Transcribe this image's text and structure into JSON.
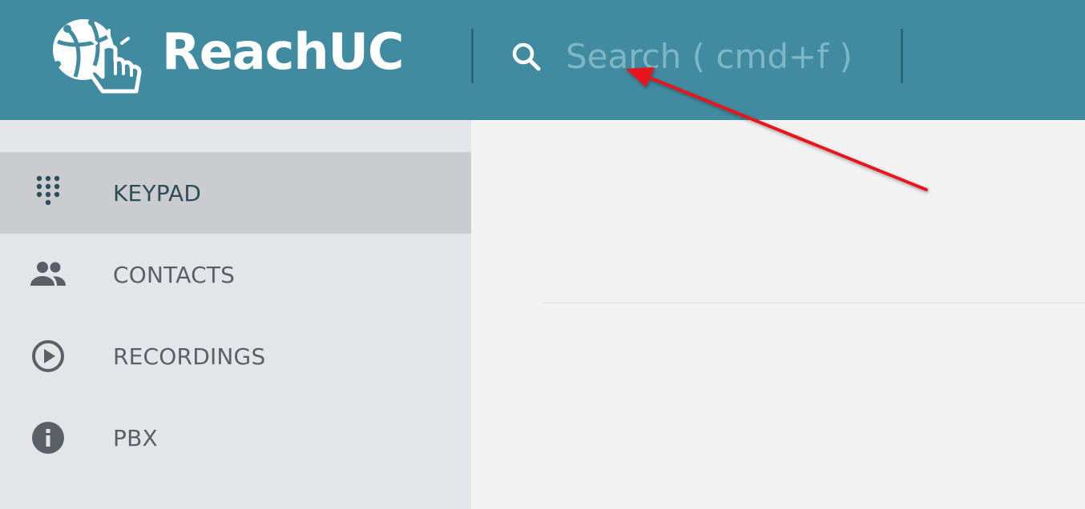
{
  "app": {
    "name": "ReachUC"
  },
  "search": {
    "placeholder": "Search ( cmd+f )",
    "value": ""
  },
  "sidebar": {
    "items": [
      {
        "label": "KEYPAD",
        "icon": "keypad-icon",
        "active": true
      },
      {
        "label": "CONTACTS",
        "icon": "contacts-icon",
        "active": false
      },
      {
        "label": "RECORDINGS",
        "icon": "play-circle-icon",
        "active": false
      },
      {
        "label": "PBX",
        "icon": "info-icon",
        "active": false
      }
    ]
  },
  "colors": {
    "header": "#418ba0",
    "sidebar": "#e4e5e8",
    "sidebar_active": "#cbccd0",
    "content": "#f2f2f3",
    "annotation_arrow": "#e8181b"
  }
}
